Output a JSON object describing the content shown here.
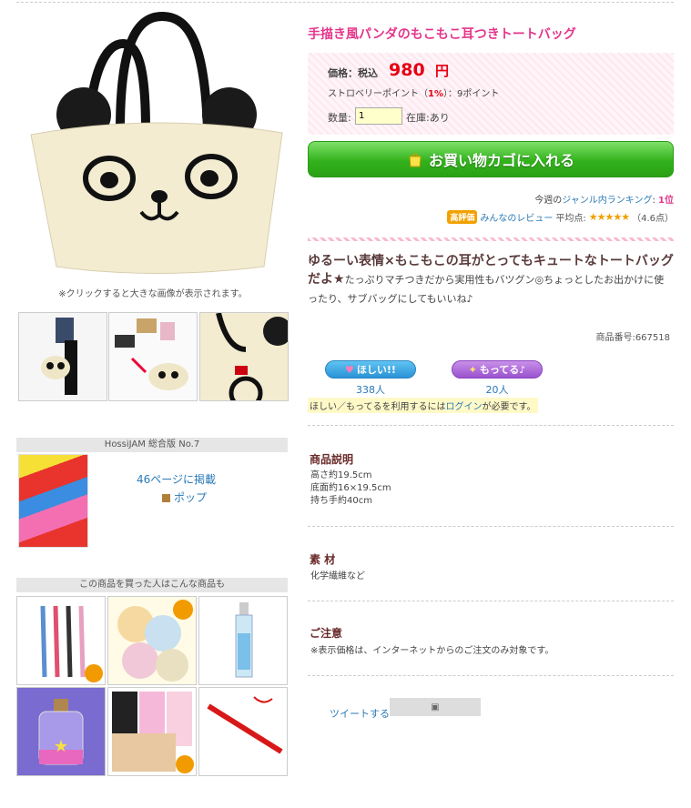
{
  "product": {
    "title": "手描き風パンダのもこもこ耳つきトートバッグ",
    "image_caption": "※クリックすると大きな画像が表示されます。",
    "price_label": "価格：税込",
    "price_value": "980",
    "price_unit": "円",
    "points_prefix": "ストロベリーポイント（",
    "points_rate": "1%",
    "points_suffix": "）：9ポイント",
    "qty_label": "数量:",
    "qty_value": "1",
    "stock": "在庫:あり",
    "cart_button": "お買い物カゴに入れる",
    "ranking_prefix": "今週の",
    "ranking_link": "ジャンル内ランキング",
    "ranking_sep": ": ",
    "ranking_value": "1位",
    "review_badge": "高評価",
    "review_link": "みんなのレビュー",
    "review_label": "平均点:",
    "review_stars": "★★★★★",
    "review_score": "（4.6点）",
    "catch_bold": "ゆるーい表情×もこもこの耳がとってもキュートなトートバッグだよ★",
    "catch_text": "たっぷりマチつきだから実用性もバツグン◎ちょっとしたお出かけに使ったり、サブバッグにしてもいいね♪",
    "product_no": "商品番号:667518"
  },
  "want": {
    "want_label": "ほしい!!",
    "want_count": "338人",
    "have_label": "もってる♪",
    "have_count": "20人",
    "note_prefix": "ほしい／もってるを利用するには",
    "note_link": "ログイン",
    "note_suffix": "が必要です。"
  },
  "sections": {
    "desc_heading": "商品説明",
    "desc_lines": [
      "高さ約19.5cm",
      "底面約16×19.5cm",
      "持ち手約40cm"
    ],
    "material_heading": "素 材",
    "material_text": "化学繊維など",
    "notice_heading": "ご注意",
    "notice_text": "※表示価格は、インターネットからのご注文のみ対象です。"
  },
  "tweet": {
    "label": "ツイートする"
  },
  "catalog": {
    "heading": "HossiJAM 総合版 No.7",
    "page": "46ページに掲載",
    "link": "ポップ"
  },
  "also_bought": {
    "heading": "この商品を買った人はこんな商品も",
    "items": [
      "シャープペンシル",
      "缶ミラー",
      "ボトル",
      "星の小瓶",
      "シール",
      "ペン"
    ]
  },
  "colors": {
    "accent": "#e4358b",
    "price": "#e60012",
    "link": "#2a7ab8",
    "cart": "#33b21c"
  }
}
